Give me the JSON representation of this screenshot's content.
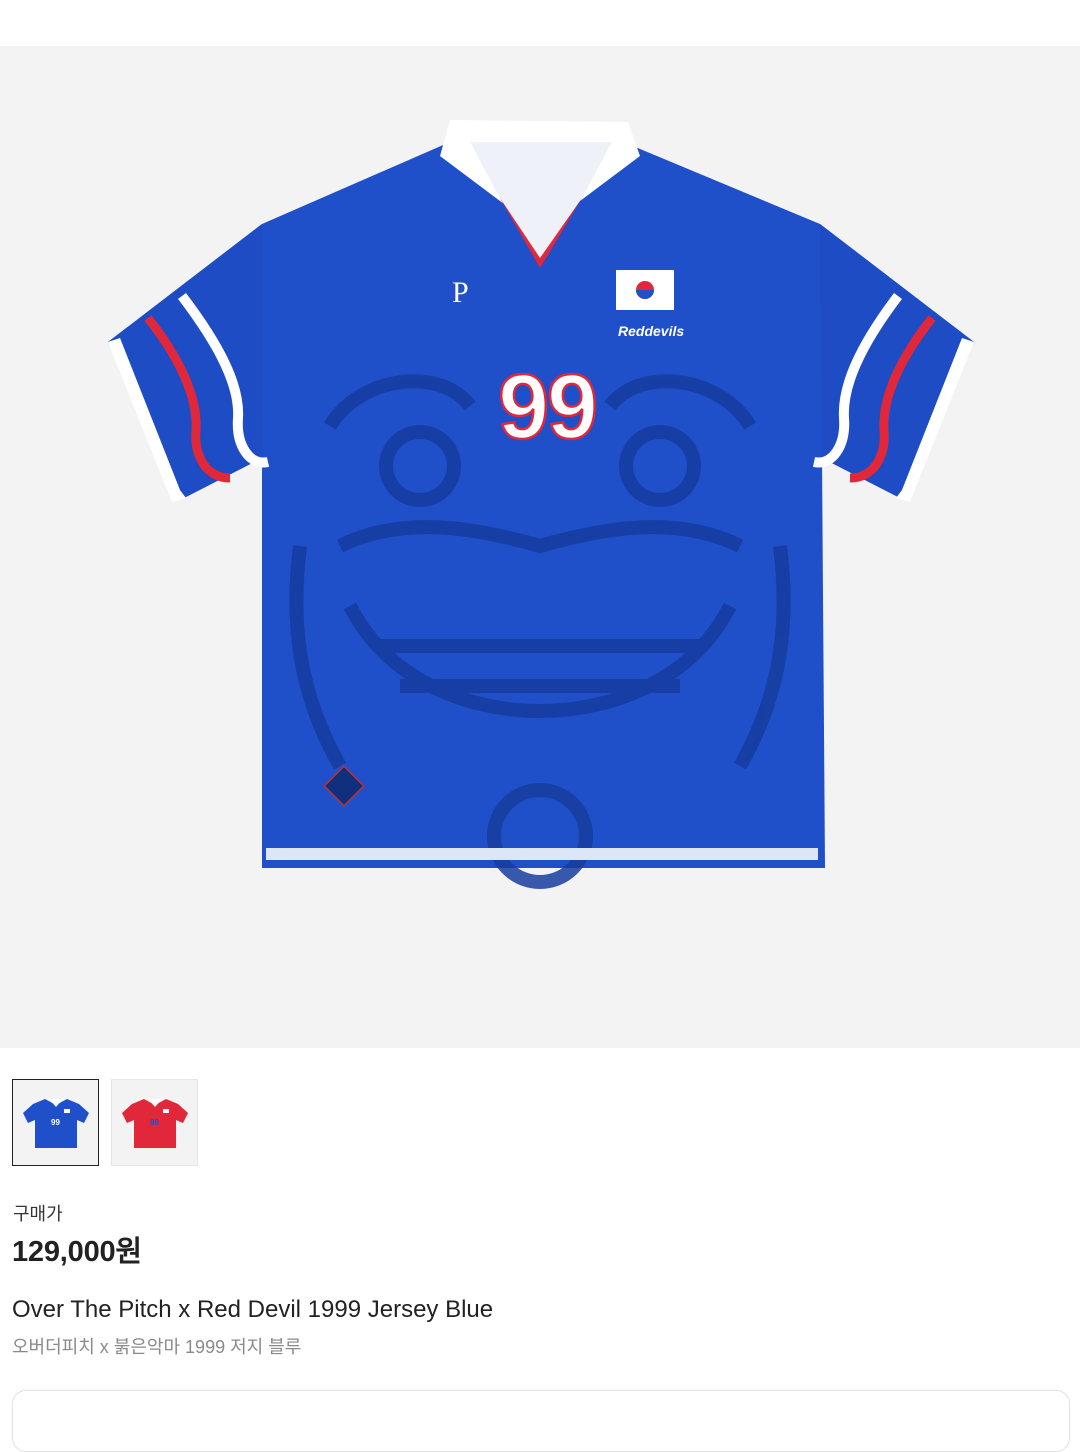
{
  "product": {
    "image_alt": "Over The Pitch x Red Devil 1999 Jersey Blue",
    "jersey_number": "99",
    "price_label": "구매가",
    "price": "129,000원",
    "title_en": "Over The Pitch x Red Devil 1999 Jersey Blue",
    "title_ko": "오버더피치 x 붉은악마 1999 저지 블루"
  },
  "thumbnails": [
    {
      "name": "blue",
      "number": "99",
      "selected": true
    },
    {
      "name": "red",
      "number": "99",
      "selected": false
    }
  ],
  "colors": {
    "jersey_blue": "#1f4fc9",
    "jersey_dark": "#163c9e",
    "accent_red": "#e0283a",
    "collar_white": "#ffffff",
    "hero_bg": "#f3f3f3"
  }
}
